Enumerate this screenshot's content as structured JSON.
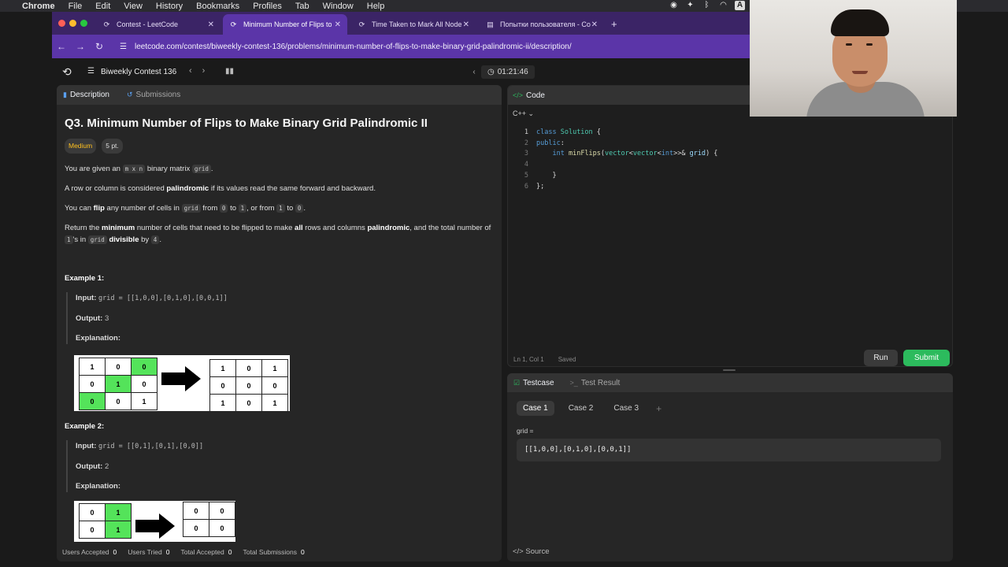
{
  "menubar": {
    "apple": "",
    "items": [
      "Chrome",
      "File",
      "Edit",
      "View",
      "History",
      "Bookmarks",
      "Profiles",
      "Tab",
      "Window",
      "Help"
    ]
  },
  "tabs": [
    {
      "label": "Contest - LeetCode",
      "icon": "leetcode-icon"
    },
    {
      "label": "Minimum Number of Flips to M",
      "icon": "leetcode-icon"
    },
    {
      "label": "Time Taken to Mark All Nodes",
      "icon": "leetcode-icon"
    },
    {
      "label": "Попытки пользователя - Co",
      "icon": "doc-icon"
    }
  ],
  "address": {
    "url": "leetcode.com/contest/biweekly-contest-136/problems/minimum-number-of-flips-to-make-binary-grid-palindromic-ii/description/"
  },
  "lcnav": {
    "contest_title": "Biweekly Contest 136",
    "timer": "01:21:46"
  },
  "left_tabs": {
    "description": "Description",
    "submissions": "Submissions"
  },
  "problem": {
    "title": "Q3. Minimum Number of Flips to Make Binary Grid Palindromic II",
    "difficulty": "Medium",
    "points": "5 pt.",
    "p1_a": "You are given an ",
    "p1_code": "m x n",
    "p1_b": " binary matrix ",
    "p1_code2": "grid",
    "p1_c": ".",
    "p2_a": "A row or column is considered ",
    "p2_bold": "palindromic",
    "p2_b": " if its values read the same forward and backward.",
    "p3_a": "You can ",
    "p3_bold": "flip",
    "p3_b": " any number of cells in ",
    "p3_code": "grid",
    "p3_c": " from ",
    "p3_code2": "0",
    "p3_d": " to ",
    "p3_code3": "1",
    "p3_e": ", or from ",
    "p3_code4": "1",
    "p3_f": " to ",
    "p3_code5": "0",
    "p3_g": ".",
    "p4_a": "Return the ",
    "p4_bold": "minimum",
    "p4_b": " number of cells that need to be flipped to make ",
    "p4_bold2": "all",
    "p4_c": " rows and columns ",
    "p4_bold3": "palindromic",
    "p4_d": ", and the total number of ",
    "p4_code": "1",
    "p4_e": "'s in ",
    "p4_code2": "grid",
    "p4_f": " ",
    "p4_bold4": "divisible",
    "p4_g": " by ",
    "p4_code3": "4",
    "p4_h": ".",
    "example1": {
      "heading": "Example 1:",
      "input_label": "Input:",
      "input": "grid = [[1,0,0],[0,1,0],[0,0,1]]",
      "output_label": "Output:",
      "output": "3",
      "explanation_label": "Explanation:",
      "grid_before": [
        [
          "1",
          "0",
          "0"
        ],
        [
          "0",
          "1",
          "0"
        ],
        [
          "0",
          "0",
          "1"
        ]
      ],
      "grid_after": [
        [
          "1",
          "0",
          "1"
        ],
        [
          "0",
          "0",
          "0"
        ],
        [
          "1",
          "0",
          "1"
        ]
      ]
    },
    "example2": {
      "heading": "Example 2:",
      "input_label": "Input:",
      "input": "grid = [[0,1],[0,1],[0,0]]",
      "output_label": "Output:",
      "output": "2",
      "explanation_label": "Explanation:",
      "grid_before": [
        [
          "0",
          "1"
        ],
        [
          "0",
          "1"
        ]
      ],
      "grid_after": [
        [
          "0",
          "0"
        ],
        [
          "0",
          "0"
        ]
      ]
    }
  },
  "left_stats": [
    {
      "label": "Users Accepted",
      "value": "0"
    },
    {
      "label": "Users Tried",
      "value": "0"
    },
    {
      "label": "Total Accepted",
      "value": "0"
    },
    {
      "label": "Total Submissions",
      "value": "0"
    }
  ],
  "code_panel": {
    "title": "Code",
    "language": "C++",
    "line_numbers": [
      "1",
      "2",
      "3",
      "4",
      "5",
      "6"
    ],
    "cursor": "Ln 1, Col 1",
    "saved": "Saved",
    "run": "Run",
    "submit": "Submit"
  },
  "test_panel": {
    "testcase": "Testcase",
    "test_result": "Test Result",
    "cases": [
      "Case 1",
      "Case 2",
      "Case 3"
    ],
    "add": "+",
    "var_label": "grid =",
    "var_value": "[[1,0,0],[0,1,0],[0,0,1]]",
    "source": "Source"
  },
  "colors": {
    "accent_green": "#2cbb5d",
    "difficulty_medium": "#ffc01e",
    "browser_purple": "#5b35a8",
    "highlight_green": "#54e35a"
  }
}
